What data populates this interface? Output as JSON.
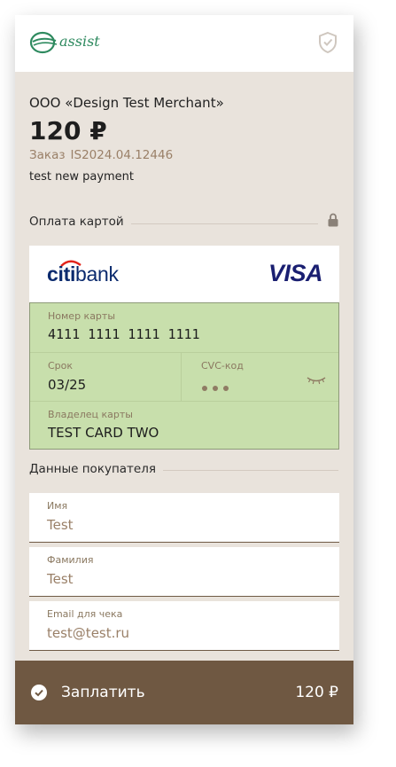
{
  "brand": {
    "logo_text": "assist",
    "logo_color": "#2e8a5f"
  },
  "merchant": "ООО «Design Test Merchant»",
  "amount": "120 ₽",
  "order": {
    "label": "Заказ",
    "number": "IS2024.04.12446"
  },
  "description": "test new payment",
  "card_section": {
    "title": "Оплата картой",
    "lock_icon": "lock-icon"
  },
  "card": {
    "bank_prefix": "citi",
    "bank_suffix": "bank",
    "network": "VISA",
    "number_label": "Номер карты",
    "number_value": "4111 1111 1111 1111",
    "expiry_label": "Срок",
    "expiry_value": "03/25",
    "cvc_label": "CVC-код",
    "holder_label": "Владелец карты",
    "holder_value": "TEST CARD TWO",
    "background_color": "#c8dfac"
  },
  "buyer_section": {
    "title": "Данные покупателя"
  },
  "buyer_fields": [
    {
      "label": "Имя",
      "value": "Test"
    },
    {
      "label": "Фамилия",
      "value": "Test"
    },
    {
      "label": "Email для чека",
      "value": "test@test.ru"
    }
  ],
  "pay_button": {
    "label": "Заплатить",
    "amount": "120 ₽",
    "color": "#6f5842"
  }
}
